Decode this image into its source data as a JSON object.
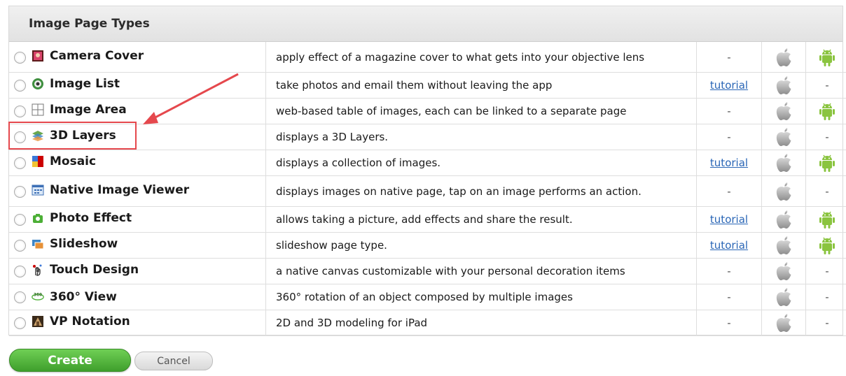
{
  "header": {
    "title": "Image Page Types"
  },
  "rows": [
    {
      "name": "Camera Cover",
      "icon": "camera-cover-icon",
      "desc": "apply effect of a magazine cover to what gets into your objective lens",
      "tutorial": "-",
      "ios": true,
      "android": true,
      "tall": true
    },
    {
      "name": "Image List",
      "icon": "image-list-icon",
      "desc": "take photos and email them without leaving the app",
      "tutorial": "tutorial",
      "ios": true,
      "android": false,
      "tall": false
    },
    {
      "name": "Image Area",
      "icon": "image-area-icon",
      "desc": "web-based table of images, each can be linked to a separate page",
      "tutorial": "-",
      "ios": true,
      "android": true,
      "tall": false
    },
    {
      "name": "3D Layers",
      "icon": "3d-layers-icon",
      "desc": "displays a 3D Layers.",
      "tutorial": "-",
      "ios": true,
      "android": false,
      "tall": false
    },
    {
      "name": "Mosaic",
      "icon": "mosaic-icon",
      "desc": "displays a collection of images.",
      "tutorial": "tutorial",
      "ios": true,
      "android": true,
      "tall": false
    },
    {
      "name": "Native Image Viewer",
      "icon": "native-image-viewer-icon",
      "desc": "displays images on native page, tap on an image performs an action.",
      "tutorial": "-",
      "ios": true,
      "android": false,
      "tall": true
    },
    {
      "name": "Photo Effect",
      "icon": "photo-effect-icon",
      "desc": "allows taking a picture, add effects and share the result.",
      "tutorial": "tutorial",
      "ios": true,
      "android": true,
      "tall": false
    },
    {
      "name": "Slideshow",
      "icon": "slideshow-icon",
      "desc": "slideshow page type.",
      "tutorial": "tutorial",
      "ios": true,
      "android": true,
      "tall": false
    },
    {
      "name": "Touch Design",
      "icon": "touch-design-icon",
      "desc": "a native canvas customizable with your personal decoration items",
      "tutorial": "-",
      "ios": true,
      "android": false,
      "tall": false
    },
    {
      "name": "360° View",
      "icon": "360-view-icon",
      "desc": "360° rotation of an object composed by multiple images",
      "tutorial": "-",
      "ios": true,
      "android": false,
      "tall": false
    },
    {
      "name": "VP Notation",
      "icon": "vp-notation-icon",
      "desc": "2D and 3D modeling for iPad",
      "tutorial": "-",
      "ios": true,
      "android": false,
      "tall": false
    }
  ],
  "buttons": {
    "create": "Create",
    "cancel": "Cancel"
  },
  "colors": {
    "accent_green": "#4caf36",
    "link_blue": "#2a66b6",
    "highlight_red": "#e5484d"
  }
}
